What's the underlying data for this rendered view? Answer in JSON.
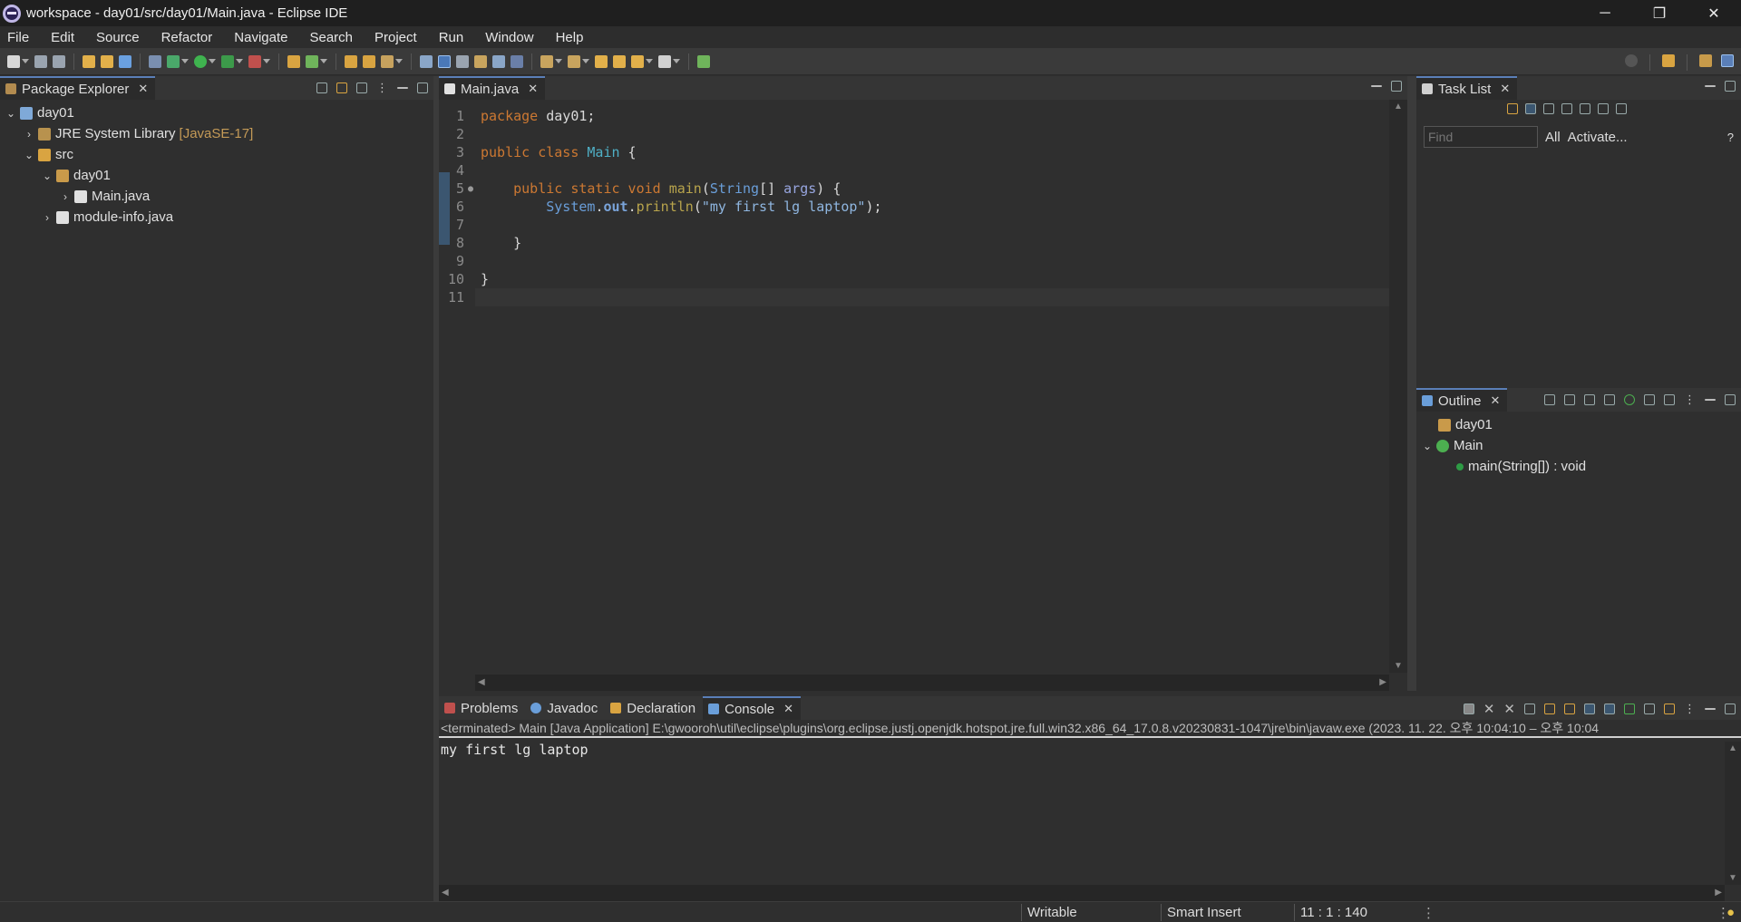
{
  "window": {
    "title": "workspace - day01/src/day01/Main.java - Eclipse IDE",
    "minimize": "─",
    "restore": "❐",
    "close": "✕"
  },
  "menu": [
    "File",
    "Edit",
    "Source",
    "Refactor",
    "Navigate",
    "Search",
    "Project",
    "Run",
    "Window",
    "Help"
  ],
  "package_explorer": {
    "tab_label": "Package Explorer",
    "tree": [
      {
        "label": "day01",
        "expanded": true
      },
      {
        "label": "JRE System Library",
        "decoration": "[JavaSE-17]",
        "expanded": false
      },
      {
        "label": "src",
        "expanded": true
      },
      {
        "label": "day01",
        "expanded": true
      },
      {
        "label": "Main.java",
        "expanded": false
      },
      {
        "label": "module-info.java",
        "expanded": false
      }
    ]
  },
  "editor": {
    "tab_label": "Main.java",
    "line_numbers": [
      "1",
      "2",
      "3",
      "4",
      "5",
      "6",
      "7",
      "8",
      "9",
      "10",
      "11"
    ],
    "lines": {
      "l1_kw": "package",
      "l1_rest": " day01;",
      "l3_kw": "public class",
      "l3_cls": "Main",
      "l3_rest": " {",
      "l5_kw": "public static void",
      "l5_fn": "main",
      "l5_type": "String",
      "l5_mid": "[] ",
      "l5_var": "args",
      "l5_rest": ") {",
      "l6_cls": "System",
      "l6_fld": "out",
      "l6_fn": "println",
      "l6_str": "\"my first lg laptop\"",
      "l6_rest": ");",
      "l8": "    }",
      "l10": "}"
    }
  },
  "task_list": {
    "tab_label": "Task List",
    "find_placeholder": "Find",
    "all_label": "All",
    "activate_label": "Activate..."
  },
  "outline": {
    "tab_label": "Outline",
    "items": [
      "day01",
      "Main",
      "main(String[]) : void"
    ]
  },
  "bottom_tabs": {
    "problems": "Problems",
    "javadoc": "Javadoc",
    "declaration": "Declaration",
    "console": "Console"
  },
  "console": {
    "header": "<terminated> Main [Java Application] E:\\gwooroh\\util\\eclipse\\plugins\\org.eclipse.justj.openjdk.hotspot.jre.full.win32.x86_64_17.0.8.v20230831-1047\\jre\\bin\\javaw.exe  (2023. 11. 22. 오후 10:04:10 – 오후 10:04",
    "output": "my first lg laptop"
  },
  "status": {
    "writable": "Writable",
    "insert_mode": "Smart Insert",
    "position": "11 : 1 : 140"
  },
  "colors": {
    "keyword": "#cc7832",
    "string": "#8fb6e0",
    "active_tab_accent": "#5a7fb8"
  }
}
